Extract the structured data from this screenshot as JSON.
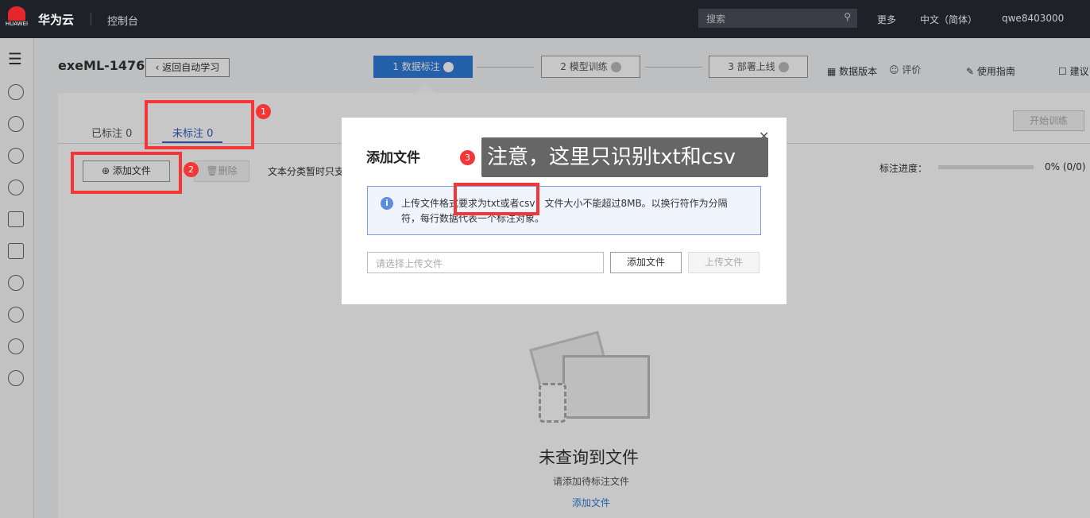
{
  "topbar": {
    "brand": "华为云",
    "logo_text": "HUAWEI",
    "console": "控制台",
    "search_placeholder": "搜索",
    "more": "更多",
    "language": "中文（简体）",
    "user": "qwe8403000"
  },
  "header": {
    "project": "exeML-1476",
    "back": "返回自动学习",
    "steps": [
      {
        "label": "1 数据标注",
        "active": true
      },
      {
        "label": "2 模型训练"
      },
      {
        "label": "3 部署上线"
      }
    ],
    "links": [
      "数据版本",
      "评价",
      "使用指南",
      "建议"
    ]
  },
  "tabs": [
    {
      "label": "已标注 0"
    },
    {
      "label": "未标注 0",
      "active": true
    }
  ],
  "toolbar": {
    "add_file": "添加文件",
    "delete": "删除",
    "hint": "文本分类暂时只支",
    "start_training": "开始训练",
    "progress_label": "标注进度：",
    "progress_text": "0% (0/0)",
    "progress": 0
  },
  "empty": {
    "title": "未查询到文件",
    "subtitle": "请添加待标注文件",
    "link": "添加文件"
  },
  "modal": {
    "title": "添加文件",
    "info": "上传文件格式要求为txt或者csv，文件大小不能超过8MB。以换行符作为分隔符，每行数据代表一个标注对象。",
    "file_placeholder": "请选择上传文件",
    "add_file": "添加文件",
    "upload": "上传文件"
  },
  "annotations": {
    "badges": [
      "1",
      "2",
      "3"
    ],
    "callout": "注意，这里只识别txt和csv",
    "color": "#f43636"
  }
}
